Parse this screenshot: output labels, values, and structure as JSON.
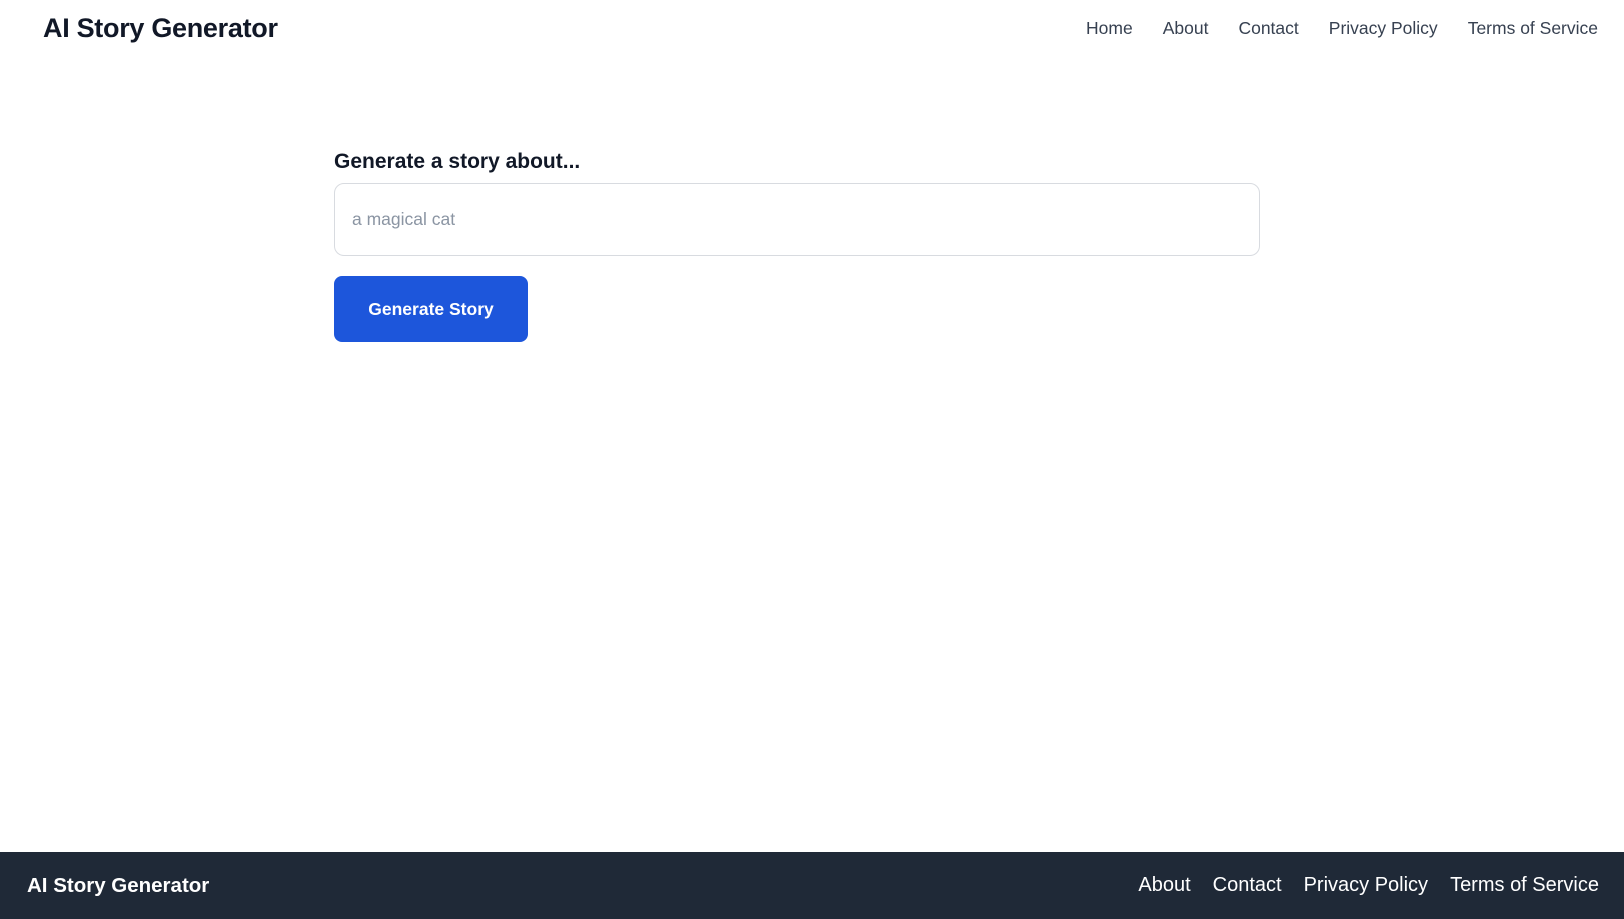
{
  "page": {
    "title": "AI Story Generator"
  },
  "header": {
    "brand": "AI Story Generator",
    "nav": [
      {
        "label": "Home"
      },
      {
        "label": "About"
      },
      {
        "label": "Contact"
      },
      {
        "label": "Privacy Policy"
      },
      {
        "label": "Terms of Service"
      }
    ]
  },
  "form": {
    "label": "Generate a story about...",
    "input_value": "",
    "input_placeholder": "a magical cat",
    "submit_label": "Generate Story"
  },
  "footer": {
    "brand": "AI Story Generator",
    "links": [
      {
        "label": "About"
      },
      {
        "label": "Contact"
      },
      {
        "label": "Privacy Policy"
      },
      {
        "label": "Terms of Service"
      }
    ]
  },
  "colors": {
    "accent_blue": "#1d56db",
    "footer_bg": "#1f2937",
    "heading_text": "#111827",
    "nav_link_text": "#374151",
    "placeholder_text": "#8b95a3",
    "input_border": "#d8dbe0"
  }
}
